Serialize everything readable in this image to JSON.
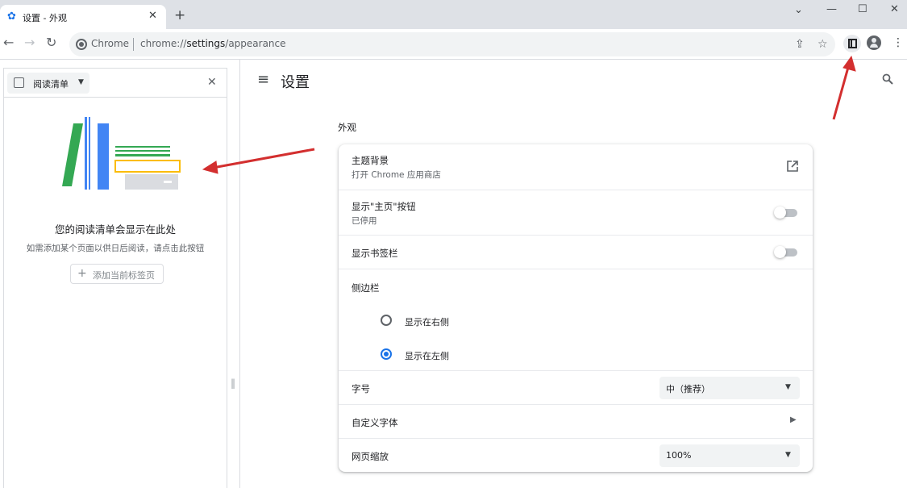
{
  "browser": {
    "tab_title": "设置 - 外观",
    "tab_close": "✕",
    "new_tab": "+",
    "window_controls": [
      "⌄",
      "—",
      "☐",
      "✕"
    ],
    "url_chip": "Chrome",
    "url_prefix": "chrome://",
    "url_host": "settings",
    "url_path": "/appearance"
  },
  "side_panel": {
    "selector_label": "阅读清单",
    "empty_title": "您的阅读清单会显示在此处",
    "empty_desc": "如需添加某个页面以供日后阅读，请点击此按钮",
    "add_button": "添加当前标签页"
  },
  "settings": {
    "title": "设置",
    "section": "外观",
    "rows": {
      "theme": {
        "primary": "主题背景",
        "secondary": "打开 Chrome 应用商店"
      },
      "home_button": {
        "primary": "显示\"主页\"按钮",
        "secondary": "已停用",
        "enabled": false
      },
      "bookmarks_bar": {
        "primary": "显示书签栏",
        "enabled": false
      },
      "side_panel": {
        "primary": "侧边栏",
        "options": [
          "显示在右侧",
          "显示在左侧"
        ],
        "selected": "显示在左侧"
      },
      "font_size": {
        "primary": "字号",
        "value": "中（推荐）"
      },
      "custom_fonts": {
        "primary": "自定义字体"
      },
      "page_zoom": {
        "primary": "网页缩放",
        "value": "100%"
      }
    }
  },
  "colors": {
    "accent": "#1a73e8",
    "annotation_arrow": "#d32f2f"
  }
}
